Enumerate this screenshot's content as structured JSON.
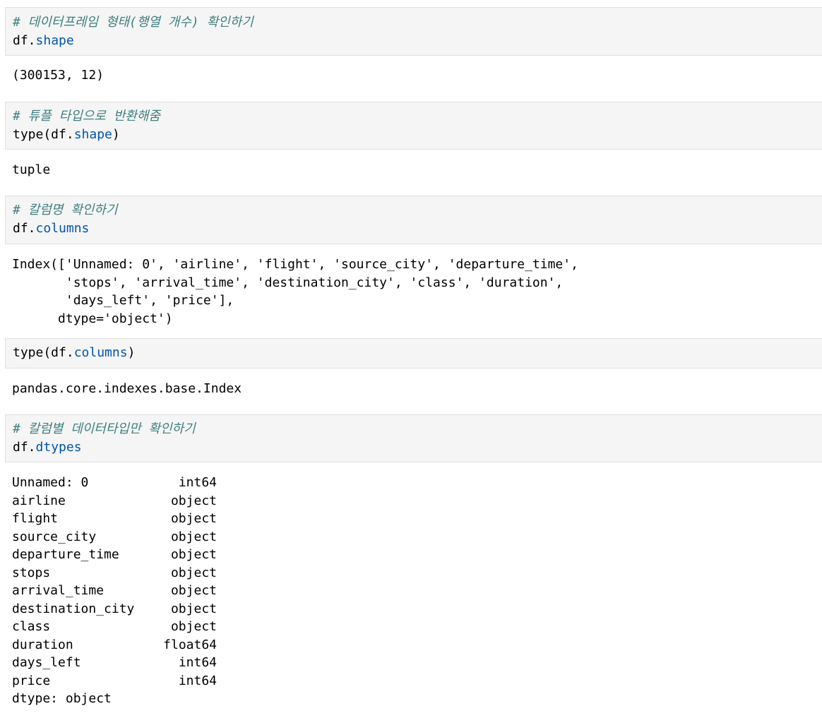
{
  "cells": [
    {
      "comment": "# 데이터프레임 형태(행열 개수) 확인하기",
      "code_prefix": "df.",
      "code_attr": "shape",
      "code_suffix": "",
      "output": [
        "(300153, 12)"
      ]
    },
    {
      "comment": "# 튜플 타입으로 반환해줌",
      "code_prefix": "type(df.",
      "code_attr": "shape",
      "code_suffix": ")",
      "output": [
        "tuple"
      ]
    },
    {
      "comment": "# 칼럼명 확인하기",
      "code_prefix": "df.",
      "code_attr": "columns",
      "code_suffix": "",
      "output": [
        "Index(['Unnamed: 0', 'airline', 'flight', 'source_city', 'departure_time',",
        "       'stops', 'arrival_time', 'destination_city', 'class', 'duration',",
        "       'days_left', 'price'],",
        "      dtype='object')"
      ]
    },
    {
      "code_prefix": "type(df.",
      "code_attr": "columns",
      "code_suffix": ")",
      "output": [
        "pandas.core.indexes.base.Index"
      ]
    },
    {
      "comment": "# 칼럼별 데이터타입만 확인하기",
      "code_prefix": "df.",
      "code_attr": "dtypes",
      "code_suffix": "",
      "dtypes": [
        {
          "name": "Unnamed: 0",
          "type": "int64"
        },
        {
          "name": "airline",
          "type": "object"
        },
        {
          "name": "flight",
          "type": "object"
        },
        {
          "name": "source_city",
          "type": "object"
        },
        {
          "name": "departure_time",
          "type": "object"
        },
        {
          "name": "stops",
          "type": "object"
        },
        {
          "name": "arrival_time",
          "type": "object"
        },
        {
          "name": "destination_city",
          "type": "object"
        },
        {
          "name": "class",
          "type": "object"
        },
        {
          "name": "duration",
          "type": "float64"
        },
        {
          "name": "days_left",
          "type": "int64"
        },
        {
          "name": "price",
          "type": "int64"
        }
      ],
      "dtype_footer": "dtype: object"
    }
  ],
  "colors": {
    "comment": "#408080",
    "attribute": "#0055aa",
    "input_background": "#f5f5f5"
  }
}
